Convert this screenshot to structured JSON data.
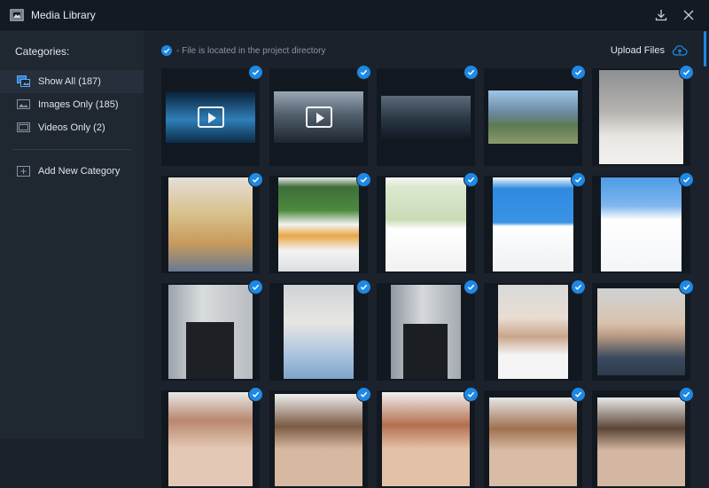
{
  "window": {
    "title": "Media Library"
  },
  "sidebar": {
    "header": "Categories:",
    "items": [
      {
        "label": "Show All (187)",
        "icon": "media-all-icon"
      },
      {
        "label": "Images Only (185)",
        "icon": "image-icon"
      },
      {
        "label": "Videos Only (2)",
        "icon": "video-icon"
      }
    ],
    "add_label": "Add New Category"
  },
  "main": {
    "legend": "- File is located in the project directory",
    "upload_label": "Upload Files"
  },
  "colors": {
    "accent": "#1e88e5",
    "background": "#1b222c",
    "sidebar": "#1f2731",
    "titlebar": "#141a22"
  }
}
